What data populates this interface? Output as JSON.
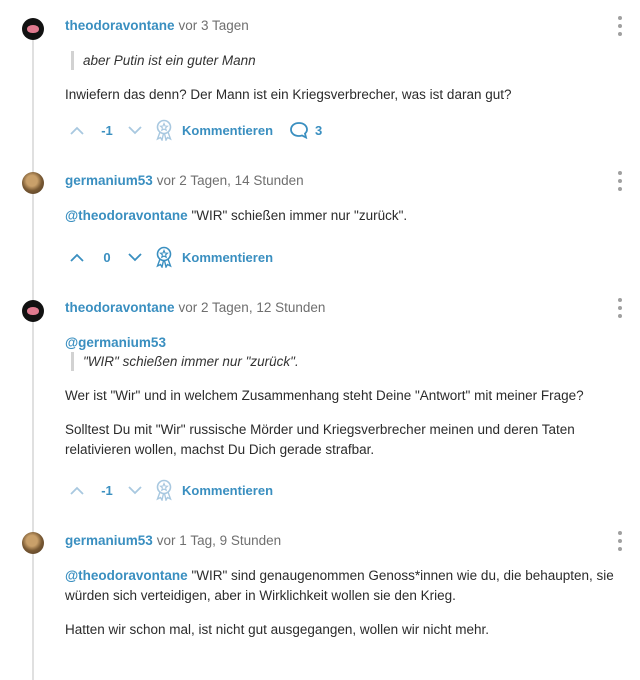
{
  "comments": [
    {
      "user": "theodoravontane",
      "time": "vor 3 Tagen",
      "quote": "aber Putin ist ein guter Mann",
      "paragraphs": [
        "Inwiefern das denn? Der Mann ist ein Kriegsverbrecher, was ist daran gut?"
      ],
      "score": "-1",
      "comment_label": "Kommentieren",
      "reply_count": "3"
    },
    {
      "user": "germanium53",
      "time": "vor 2 Tagen, 14 Stunden",
      "mention": "@theodoravontane",
      "mention_text": " \"WIR\" schießen immer nur \"zurück\".",
      "score": "0",
      "comment_label": "Kommentieren"
    },
    {
      "user": "theodoravontane",
      "time": "vor 2 Tagen, 12 Stunden",
      "quote_author": "@germanium53",
      "quote": "\"WIR\" schießen immer nur \"zurück\".",
      "paragraphs": [
        "Wer ist \"Wir\" und in welchem Zusammenhang steht Deine \"Antwort\" mit meiner Frage?",
        "Solltest Du mit \"Wir\" russische Mörder und Kriegsverbrecher meinen und deren Taten relativieren wollen, machst Du Dich gerade strafbar."
      ],
      "score": "-1",
      "comment_label": "Kommentieren"
    },
    {
      "user": "germanium53",
      "time": "vor 1 Tag, 9 Stunden",
      "mention": "@theodoravontane",
      "mention_text": " \"WIR\" sind genaugenommen Genoss*innen wie du, die behaupten, sie würden sich verteidigen, aber in Wirklichkeit wollen sie den Krieg.",
      "paragraphs": [
        "Hatten wir schon mal, ist nicht gut ausgegangen, wollen wir nicht mehr."
      ]
    }
  ],
  "icons": {
    "upvote": "chevron-up-icon",
    "downvote": "chevron-down-icon",
    "comment": "award-ribbon-icon",
    "replies": "speech-bubble-icon",
    "menu": "more-vertical-icon"
  },
  "colors": {
    "accent": "#3a8fc0",
    "muted": "#6f6f6f"
  }
}
